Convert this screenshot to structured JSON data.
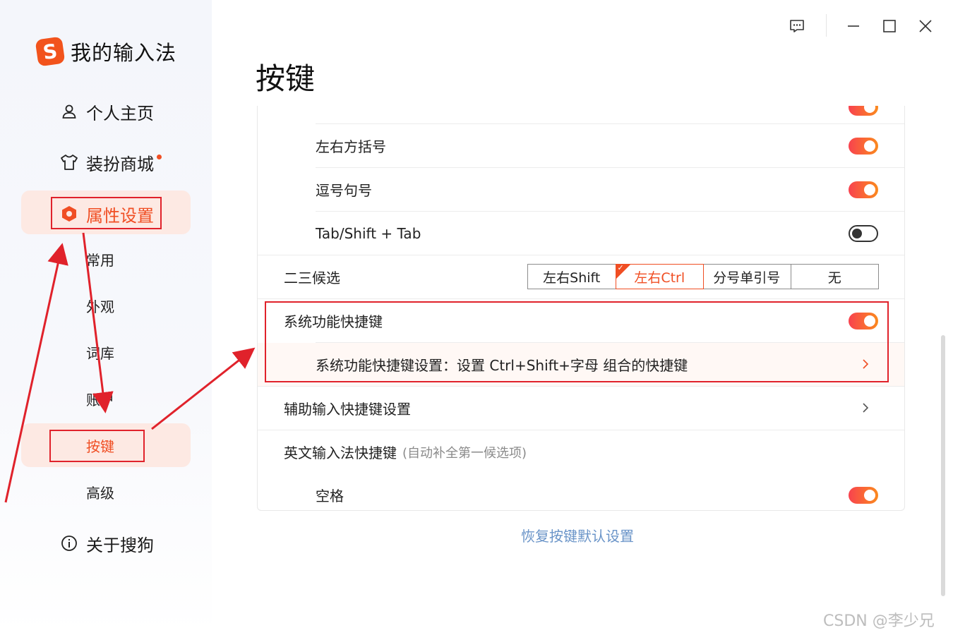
{
  "app": {
    "name": "我的输入法",
    "logo_letter": "S"
  },
  "sidebar": {
    "items": [
      {
        "label": "个人主页",
        "icon": "user-icon"
      },
      {
        "label": "装扮商城",
        "icon": "shirt-icon"
      },
      {
        "label": "属性设置",
        "icon": "settings-hex-icon"
      },
      {
        "label": "关于搜狗",
        "icon": "info-icon"
      }
    ],
    "sub_items": [
      "常用",
      "外观",
      "词库",
      "账户",
      "按键",
      "高级"
    ],
    "active_item": "属性设置",
    "active_sub": "按键"
  },
  "window_controls": [
    "feedback-icon",
    "minimize-icon",
    "maximize-icon",
    "close-icon"
  ],
  "page": {
    "title": "按键"
  },
  "rows": {
    "bracket": "左右方括号",
    "comma": "逗号句号",
    "tab_shift": "Tab/Shift + Tab",
    "second_third": "二三候选",
    "sys_shortcut": "系统功能快捷键",
    "sys_shortcut_setting": "系统功能快捷键设置：设置 Ctrl+Shift+字母 组合的快捷键",
    "aux_shortcut": "辅助输入快捷键设置",
    "en_shortcut": "英文输入法快捷键",
    "en_shortcut_hint": "(自动补全第一候选项)",
    "space": "空格"
  },
  "toggles": {
    "bracket": true,
    "comma": true,
    "tab_shift": false,
    "sys_shortcut": true,
    "space": true
  },
  "second_third_options": [
    "左右Shift",
    "左右Ctrl",
    "分号单引号",
    "无"
  ],
  "second_third_selected": "左右Ctrl",
  "restore_link": "恢复按键默认设置",
  "watermark": "CSDN @李少兄",
  "colors": {
    "accent": "#f04e23",
    "annotation": "#e0222b",
    "link": "#6a94c8"
  }
}
